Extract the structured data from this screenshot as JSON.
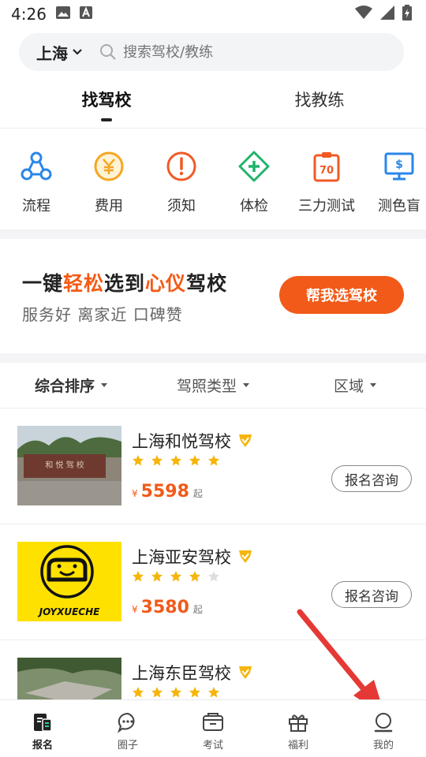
{
  "status": {
    "time": "4:26"
  },
  "search": {
    "city": "上海",
    "placeholder": "搜索驾校/教练"
  },
  "top_tabs": [
    {
      "label": "找驾校",
      "active": true
    },
    {
      "label": "找教练",
      "active": false
    }
  ],
  "categories": [
    {
      "label": "流程",
      "icon": "process-icon",
      "color": "#2b86e8"
    },
    {
      "label": "费用",
      "icon": "yen-icon",
      "color": "#f6a623"
    },
    {
      "label": "须知",
      "icon": "notice-icon",
      "color": "#f05a24"
    },
    {
      "label": "体检",
      "icon": "medical-icon",
      "color": "#1fb46a"
    },
    {
      "label": "三力测试",
      "icon": "test-icon",
      "color": "#f05a24"
    },
    {
      "label": "测色盲",
      "icon": "color-test-icon",
      "color": "#2b86e8"
    }
  ],
  "banner": {
    "title_part1": "一键",
    "title_highlight1": "轻松",
    "title_part2": "选到",
    "title_highlight2": "心仪",
    "title_part3": "驾校",
    "subtitle": "服务好  离家近  口碑赞",
    "button": "帮我选驾校"
  },
  "filters": [
    {
      "label": "综合排序"
    },
    {
      "label": "驾照类型"
    },
    {
      "label": "区域"
    }
  ],
  "schools": [
    {
      "name": "上海和悦驾校",
      "rating": 5,
      "currency": "¥",
      "price": "5598",
      "price_suffix": "起",
      "button": "报名咨询",
      "image_text": "和 悦 驾 校"
    },
    {
      "name": "上海亚安驾校",
      "rating": 4,
      "currency": "¥",
      "price": "3580",
      "price_suffix": "起",
      "button": "报名咨询",
      "image_text": "JOYXUECHE"
    },
    {
      "name": "上海东臣驾校",
      "rating": 5,
      "currency": "",
      "price": "",
      "price_suffix": "",
      "button": "",
      "image_text": ""
    }
  ],
  "bottom_nav": [
    {
      "label": "报名",
      "icon": "signup-icon",
      "active": true
    },
    {
      "label": "圈子",
      "icon": "chat-icon",
      "active": false
    },
    {
      "label": "考试",
      "icon": "exam-icon",
      "active": false
    },
    {
      "label": "福利",
      "icon": "gift-icon",
      "active": false
    },
    {
      "label": "我的",
      "icon": "profile-icon",
      "active": false
    }
  ],
  "colors": {
    "accent": "#f15a18",
    "gold": "#f5b50a",
    "arrow": "#e53935"
  }
}
